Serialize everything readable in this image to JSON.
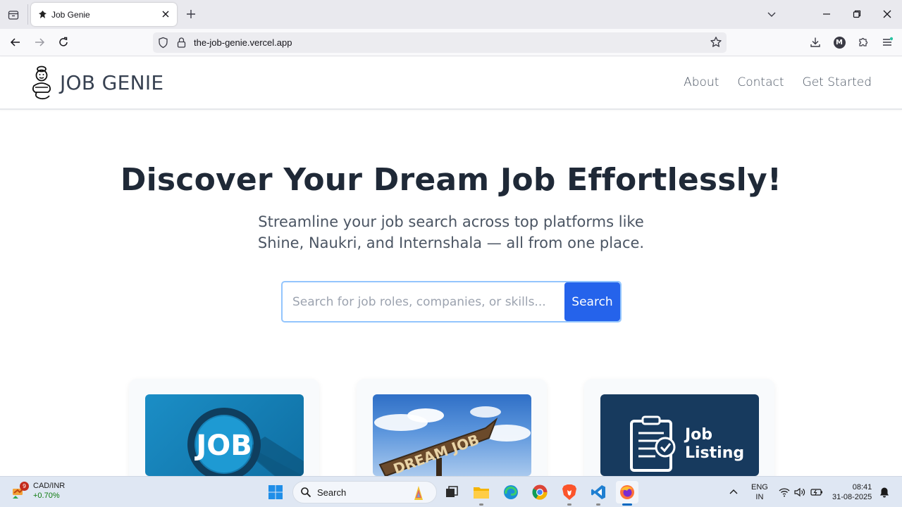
{
  "browser": {
    "tab": {
      "title": "Job Genie"
    },
    "url": "the-job-genie.vercel.app",
    "profile_initial": "M"
  },
  "site": {
    "brand": "JOB GENIE",
    "nav": [
      "About",
      "Contact",
      "Get Started"
    ],
    "hero": {
      "title": "Discover Your Dream Job Effortlessly!",
      "subtitle": "Streamline your job search across top platforms like Shine, Naukri, and Internshala — all from one place."
    },
    "search": {
      "placeholder": "Search for job roles, companies, or skills...",
      "button": "Search"
    },
    "cards": [
      {
        "image_text": "JOB"
      },
      {
        "image_text": "DREAM JOB"
      },
      {
        "image_text_1": "Job",
        "image_text_2": "Listing"
      }
    ]
  },
  "taskbar": {
    "widget": {
      "badge": "9",
      "pair": "CAD/INR",
      "change": "+0.70%"
    },
    "search_label": "Search",
    "lang": {
      "line1": "ENG",
      "line2": "IN"
    },
    "clock": {
      "time": "08:41",
      "date": "31-08-2025"
    }
  },
  "colors": {
    "accent": "#2563eb",
    "heading": "#1f2937",
    "search_border": "#93c5fd"
  }
}
